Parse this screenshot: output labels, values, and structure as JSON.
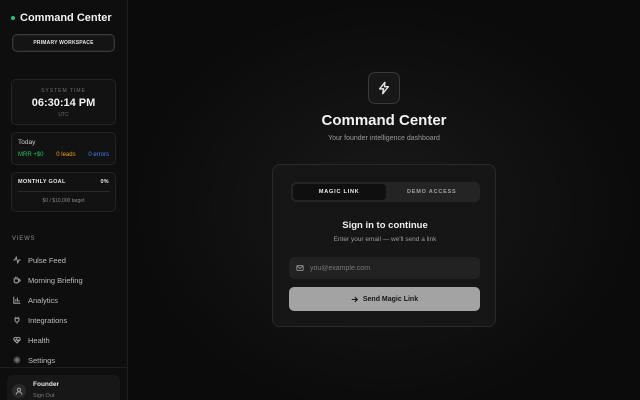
{
  "sidebar": {
    "brand": "Command Center",
    "workspace_button": "PRIMARY WORKSPACE",
    "system_time": {
      "label": "SYSTEM TIME",
      "value": "06:30:14 PM",
      "zone": "UTC"
    },
    "today": {
      "label": "Today",
      "mrr": "MRR +$0",
      "leads": "0 leads",
      "errors": "0 errors"
    },
    "goal": {
      "label": "MONTHLY GOAL",
      "percent": "0%",
      "progress": 0,
      "subtitle": "$0 / $10,000 target"
    },
    "views_title": "VIEWS",
    "nav_items": [
      {
        "label": "Pulse Feed",
        "icon": "activity-icon"
      },
      {
        "label": "Morning Briefing",
        "icon": "coffee-icon"
      },
      {
        "label": "Analytics",
        "icon": "bar-chart-icon"
      },
      {
        "label": "Integrations",
        "icon": "plug-icon"
      },
      {
        "label": "Health",
        "icon": "heart-pulse-icon"
      },
      {
        "label": "Settings",
        "icon": "gear-icon"
      }
    ],
    "user": {
      "name": "Founder",
      "signout": "Sign Out"
    }
  },
  "main": {
    "title": "Command Center",
    "subtitle": "Your founder intelligence dashboard",
    "tabs": [
      {
        "label": "MAGIC LINK",
        "active": true
      },
      {
        "label": "DEMO ACCESS",
        "active": false
      }
    ],
    "signin_title": "Sign in to continue",
    "signin_subtitle": "Enter your email — we'll send a link",
    "email": {
      "value": "",
      "placeholder": "you@example.com"
    },
    "send_button": "Send Magic Link"
  },
  "colors": {
    "accent_green": "#22c55e",
    "accent_amber": "#f59e0b",
    "accent_blue": "#3b82f6",
    "button_bg": "#a3a3a3"
  }
}
